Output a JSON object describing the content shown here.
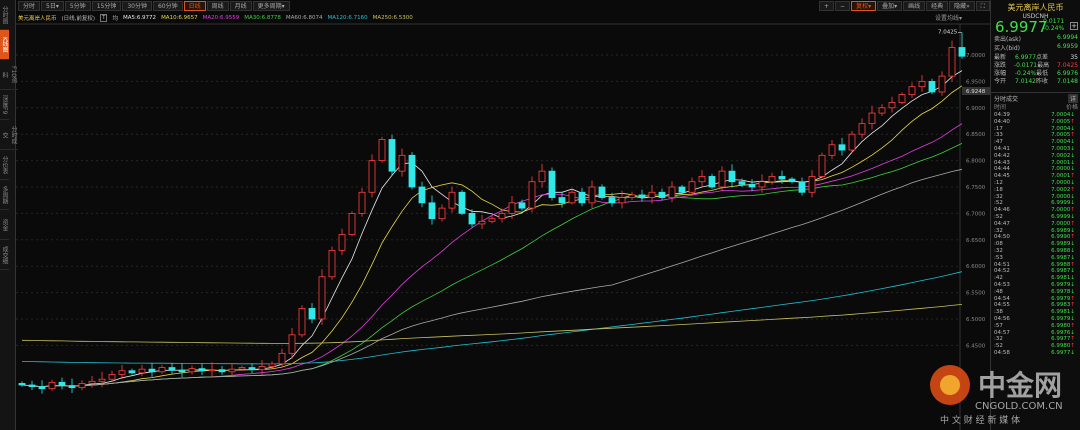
{
  "sidebar": {
    "items": [
      "分时图",
      "K线图",
      "F10资料",
      "深度F9",
      "分时成交",
      "分价表",
      "多周期",
      "资金",
      "成交细"
    ],
    "active": 1
  },
  "toolbar": {
    "periods": [
      "分时",
      "5日▾",
      "5分钟",
      "15分钟",
      "30分钟",
      "60分钟",
      "日线",
      "周线",
      "月线",
      "更多周期▾"
    ],
    "active": 6,
    "right": [
      "+",
      "−",
      "复权▾",
      "叠加▾",
      "画线",
      "经典",
      "隐藏»",
      "⛶"
    ],
    "right_active": 2,
    "set_ma": "设置均线▾"
  },
  "legend": {
    "title": "美元离岸人民币",
    "sub": "(日线,前复权)",
    "t": "T",
    "avg": "均",
    "mas": [
      {
        "label": "MA5:6.9772",
        "color": "#e8e8e8"
      },
      {
        "label": "MA10:6.9657",
        "color": "#e8d84a"
      },
      {
        "label": "MA20:6.9559",
        "color": "#e040e0"
      },
      {
        "label": "MA30:6.8778",
        "color": "#40d040"
      },
      {
        "label": "MA60:6.8074",
        "color": "#aaaaaa"
      },
      {
        "label": "MA120:6.7160",
        "color": "#20c0d0"
      },
      {
        "label": "MA250:6.5300",
        "color": "#c8c060"
      }
    ]
  },
  "quote": {
    "name": "美元离岸人民币",
    "code": "USDCNH",
    "price": "6.9977",
    "change": "-0.0171",
    "pct": "-0.24%",
    "ask_label": "卖出(ask)",
    "ask": "6.9994",
    "bid_label": "买入(bid)",
    "bid": "6.9959",
    "grid": [
      [
        "最新",
        "6.9977",
        "点差",
        "35"
      ],
      [
        "涨跌",
        "-0.0171",
        "最高",
        "7.0425"
      ],
      [
        "涨幅",
        "-0.24%",
        "最低",
        "6.9976"
      ],
      [
        "今开",
        "7.0142",
        "昨收",
        "7.0148"
      ]
    ],
    "ticks_title": "分时成交",
    "ticks_btn": "详",
    "col_time": "时间",
    "col_price": "价格"
  },
  "ticks": [
    [
      "04:39",
      "7.0004",
      "d"
    ],
    [
      "04:40",
      "7.0005",
      "u"
    ],
    [
      ":17",
      "7.0004",
      "d"
    ],
    [
      ":33",
      "7.0005",
      "u"
    ],
    [
      ":47",
      "7.0004",
      "d"
    ],
    [
      "04:41",
      "7.0003",
      "d"
    ],
    [
      "04:42",
      "7.0002",
      "d"
    ],
    [
      "04:43",
      "7.0001",
      "d"
    ],
    [
      "04:44",
      "7.0000",
      "d"
    ],
    [
      "04:45",
      "7.0001",
      "u"
    ],
    [
      ":12",
      "7.0000",
      "d"
    ],
    [
      ":18",
      "7.0002",
      "u"
    ],
    [
      ":32",
      "7.0000",
      "d"
    ],
    [
      ":52",
      "6.9999",
      "d"
    ],
    [
      "04:46",
      "7.0000",
      "u"
    ],
    [
      ":52",
      "6.9999",
      "d"
    ],
    [
      "04:47",
      "7.0000",
      "u"
    ],
    [
      ":32",
      "6.9989",
      "d"
    ],
    [
      "04:50",
      "6.9990",
      "u"
    ],
    [
      ":08",
      "6.9989",
      "d"
    ],
    [
      ":32",
      "6.9988",
      "d"
    ],
    [
      ":53",
      "6.9987",
      "d"
    ],
    [
      "04:51",
      "6.9988",
      "u"
    ],
    [
      "04:52",
      "6.9987",
      "d"
    ],
    [
      ":42",
      "6.9981",
      "d"
    ],
    [
      "04:53",
      "6.9979",
      "d"
    ],
    [
      ":48",
      "6.9978",
      "d"
    ],
    [
      "04:54",
      "6.9979",
      "u"
    ],
    [
      "04:55",
      "6.9983",
      "u"
    ],
    [
      ":38",
      "6.9981",
      "d"
    ],
    [
      "04:56",
      "6.9979",
      "d"
    ],
    [
      ":57",
      "6.9980",
      "u"
    ],
    [
      "04:57",
      "6.9976",
      "d"
    ],
    [
      ":32",
      "6.9977",
      "u"
    ],
    [
      ":52",
      "6.9980",
      "u"
    ],
    [
      "04:58",
      "6.9977",
      "d"
    ]
  ],
  "watermark": {
    "logo": "中金网",
    "url": "CNGOLD.COM.CN",
    "slogan": "中 文 财 经 新 媒 体"
  },
  "chart_data": {
    "type": "candlestick",
    "ylim": [
      6.43,
      7.05
    ],
    "yticks": [
      "7.0000",
      "6.9500",
      "6.9000",
      "6.8500",
      "6.8000",
      "6.7500",
      "6.7000",
      "6.6500",
      "6.6000",
      "6.5500",
      "6.5000",
      "6.4500"
    ],
    "cursor_label": "6.9248",
    "high_label": "7.0425",
    "high": 7.0425,
    "close": [
      6.375,
      6.372,
      6.368,
      6.38,
      6.374,
      6.37,
      6.378,
      6.382,
      6.386,
      6.395,
      6.402,
      6.398,
      6.405,
      6.4,
      6.408,
      6.403,
      6.4,
      6.406,
      6.402,
      6.404,
      6.4,
      6.405,
      6.408,
      6.404,
      6.41,
      6.415,
      6.435,
      6.47,
      6.52,
      6.5,
      6.58,
      6.63,
      6.66,
      6.7,
      6.74,
      6.8,
      6.84,
      6.78,
      6.81,
      6.75,
      6.72,
      6.69,
      6.71,
      6.74,
      6.7,
      6.68,
      6.685,
      6.69,
      6.7,
      6.72,
      6.71,
      6.76,
      6.78,
      6.73,
      6.72,
      6.74,
      6.72,
      6.75,
      6.73,
      6.72,
      6.73,
      6.735,
      6.73,
      6.74,
      6.73,
      6.75,
      6.74,
      6.76,
      6.77,
      6.75,
      6.78,
      6.76,
      6.755,
      6.75,
      6.76,
      6.77,
      6.765,
      6.76,
      6.74,
      6.77,
      6.81,
      6.83,
      6.82,
      6.85,
      6.87,
      6.89,
      6.9,
      6.91,
      6.925,
      6.94,
      6.95,
      6.93,
      6.96,
      7.0142,
      6.9977
    ],
    "ma_periods": [
      5,
      10,
      20,
      30,
      60,
      120,
      250
    ]
  }
}
